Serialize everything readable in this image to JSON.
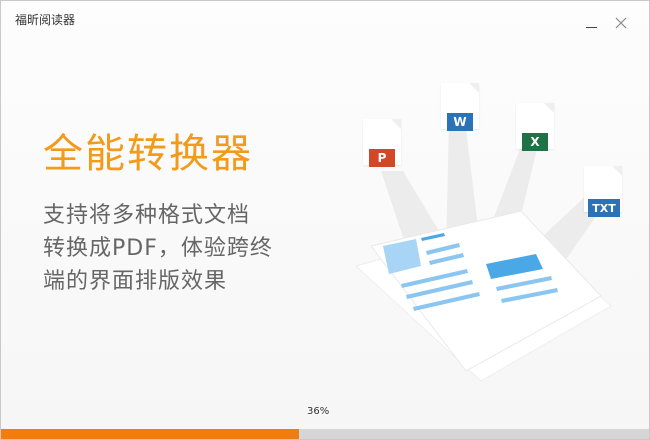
{
  "window": {
    "title": "福昕阅读器"
  },
  "controls": {
    "minimize_icon": "minimize-icon",
    "close_icon": "close-icon"
  },
  "hero": {
    "headline": "全能转换器",
    "description_lines": [
      "支持将多种格式文档",
      "转换成PDF，体验跨终",
      "端的界面排版效果"
    ]
  },
  "formats": [
    {
      "label": "P",
      "color": "#d24726"
    },
    {
      "label": "W",
      "color": "#2b73b8"
    },
    {
      "label": "X",
      "color": "#1f7246"
    },
    {
      "label": "TXT",
      "color": "#2b73b8"
    }
  ],
  "progress": {
    "label": "36%",
    "fraction": 0.46
  },
  "colors": {
    "accent": "#f29a1a",
    "progress": "#ef7d0f",
    "doc_blue": "#4aa8e6"
  }
}
